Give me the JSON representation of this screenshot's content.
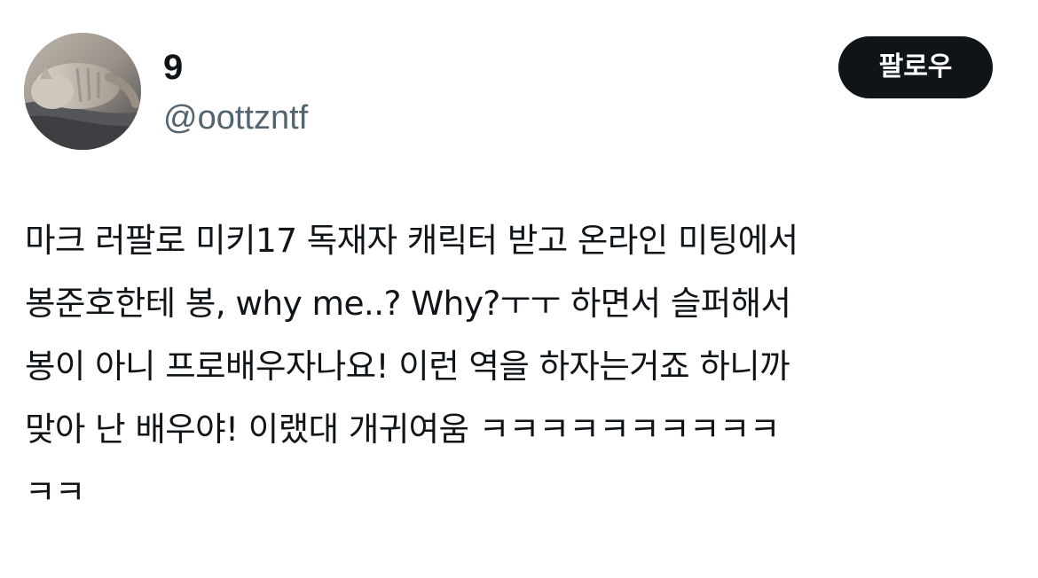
{
  "author": {
    "display_name": "9",
    "handle": "@oottzntf",
    "avatar_icon": "cat-photo-avatar"
  },
  "follow_button": {
    "label": "팔로우"
  },
  "tweet": {
    "lines": [
      "마크 러팔로 미키17 독재자 캐릭터 받고 온라인 미팅에서",
      "봉준호한테 봉, why me..? Why?ㅜㅜ 하면서 슬퍼해서",
      "봉이 아니 프로배우자나요! 이런 역을 하자는거죠 하니까",
      "맞아 난 배우야! 이랬대 개귀여움 ㅋㅋㅋㅋㅋㅋㅋㅋㅋㅋ",
      "ㅋㅋ"
    ]
  },
  "colors": {
    "text_primary": "#0f1419",
    "text_secondary": "#536471",
    "button_bg": "#0f1419",
    "button_text": "#ffffff",
    "background": "#ffffff"
  }
}
